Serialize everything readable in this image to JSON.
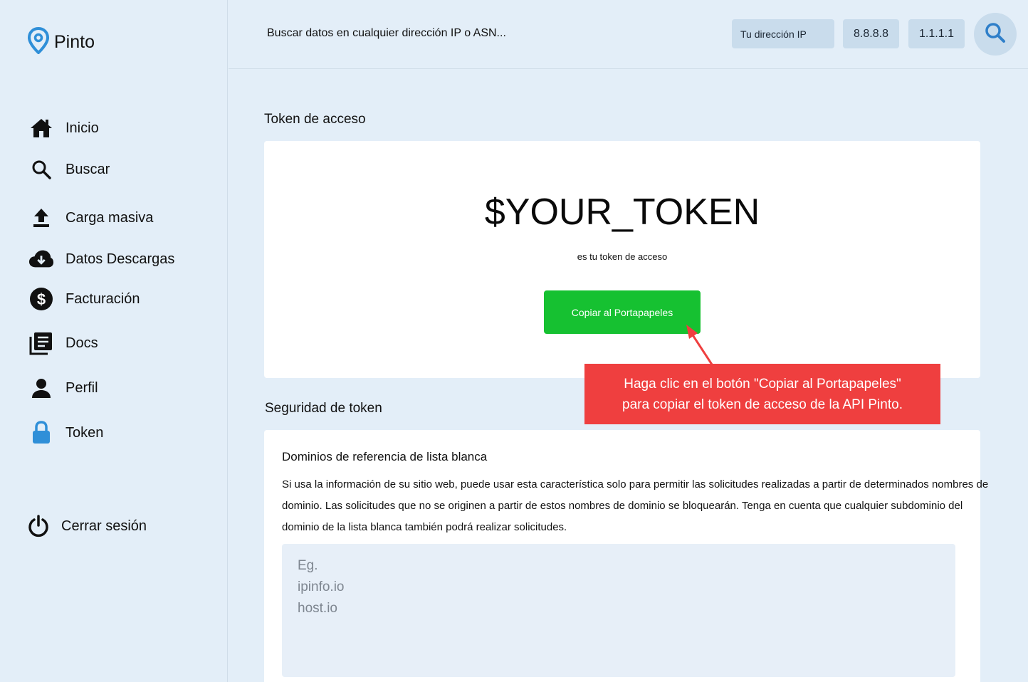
{
  "brand": {
    "name": "Pinto"
  },
  "sidebar": {
    "items": [
      {
        "label": "Inicio",
        "icon": "home-icon"
      },
      {
        "label": "Buscar",
        "icon": "search-icon"
      },
      {
        "label": "Carga masiva",
        "icon": "upload-icon"
      },
      {
        "label": "Datos  Descargas",
        "icon": "cloud-download-icon"
      },
      {
        "label": "Facturación",
        "icon": "dollar-icon"
      },
      {
        "label": "Docs",
        "icon": "docs-icon"
      },
      {
        "label": "Perfil",
        "icon": "person-icon"
      },
      {
        "label": "Token",
        "icon": "lock-icon"
      }
    ],
    "logout": {
      "label": "Cerrar sesión",
      "icon": "power-icon"
    }
  },
  "topbar": {
    "search_placeholder": "Buscar datos en cualquier dirección IP o ASN...",
    "quick_links": [
      "Tu dirección IP",
      "8.8.8.8",
      "1.1.1.1"
    ]
  },
  "token_section": {
    "title": "Token de acceso",
    "token": "$YOUR_TOKEN",
    "subtitle": "es tu token de acceso",
    "copy_label": "Copiar al Portapapeles"
  },
  "callout": {
    "text": "Haga clic en el botón \"Copiar al Portapapeles\"\npara copiar el token de acceso de la API Pinto."
  },
  "security_section": {
    "title": "Seguridad de token",
    "whitelist_title": "Dominios de referencia de lista blanca",
    "whitelist_description": "Si usa la información de su sitio web, puede usar esta característica solo para permitir las solicitudes realizadas a partir de determinados nombres de dominio. Las solicitudes que no se originen a partir de estos nombres de dominio se bloquearán. Tenga en cuenta que cualquier subdominio del dominio de la lista blanca también podrá realizar solicitudes.",
    "textarea_placeholder": "Eg.\nipinfo.io\nhost.io"
  },
  "colors": {
    "background": "#e3eef8",
    "accent_blue": "#2f8fd8",
    "copy_button": "#16c131",
    "callout": "#ef3f3f"
  }
}
